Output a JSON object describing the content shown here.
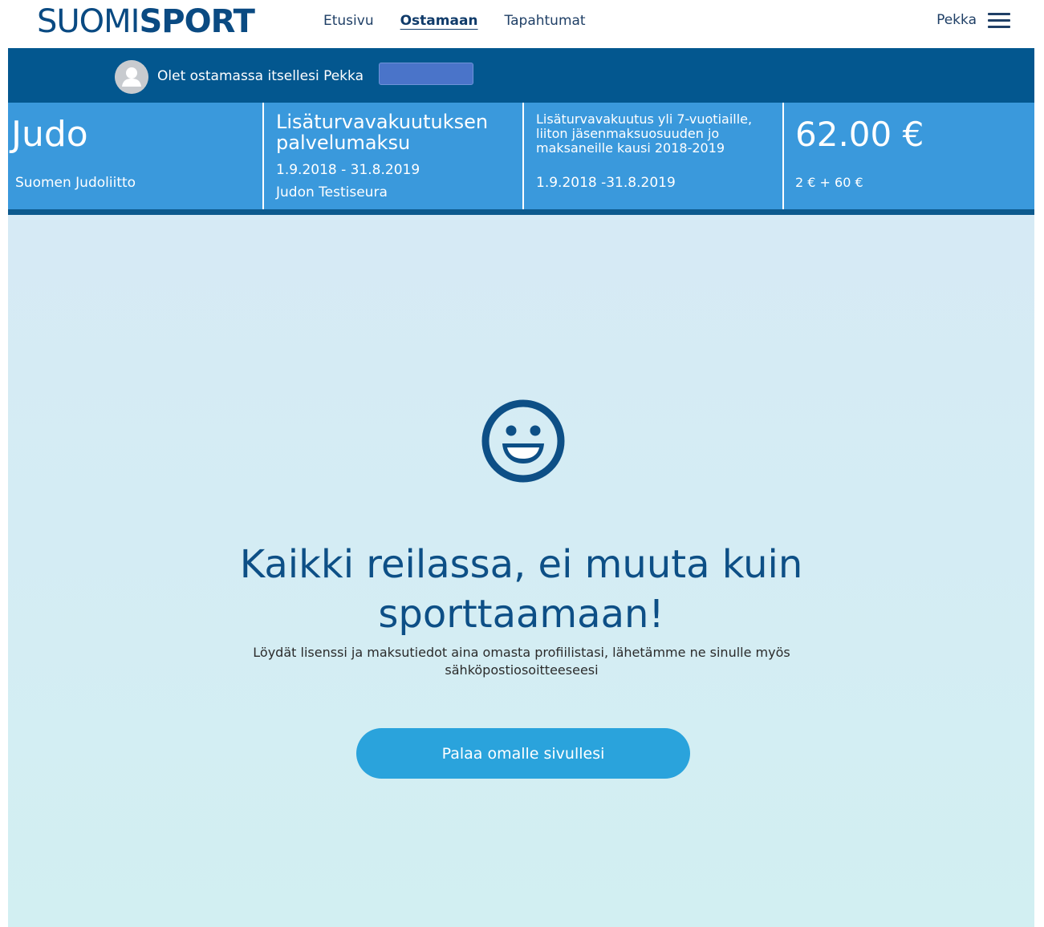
{
  "header": {
    "logo_light": "SUOMI",
    "logo_bold_1": "SP",
    "logo_bold_o": "O",
    "logo_bold_2": "RT",
    "nav": [
      {
        "label": "Etusivu",
        "active": false
      },
      {
        "label": "Ostamaan",
        "active": true
      },
      {
        "label": "Tapahtumat",
        "active": false
      }
    ],
    "user_name": "Pekka",
    "menu_icon": "hamburger-menu-icon"
  },
  "buyer": {
    "text": "Olet ostamassa itsellesi Pekka",
    "avatar_icon": "user-avatar-icon"
  },
  "product": {
    "sport": "Judo",
    "federation": "Suomen Judoliitto",
    "fee_title": "Lisäturvavakuutuksen palvelumaksu",
    "fee_period": "1.9.2018 - 31.8.2019",
    "club": "Judon Testiseura",
    "insurance_description": "Lisäturvavakuutus yli 7-vuotiaille, liiton jäsenmaksuosuuden jo maksaneille kausi 2018-2019",
    "insurance_period": "1.9.2018 -31.8.2019",
    "price": "62.00 €",
    "price_breakdown": "2 € + 60 €"
  },
  "success": {
    "icon": "smiley-face-icon",
    "heading_line1": "Kaikki reilassa, ei muuta kuin",
    "heading_line2": "sporttaamaan!",
    "subtext_line1": "Löydät lisenssi ja maksutiedot aina omasta profiilistasi, lähetämme ne sinulle myös",
    "subtext_line2": "sähköpostiosoitteeseesi",
    "button_label": "Palaa omalle sivullesi"
  },
  "colors": {
    "brand_dark": "#03578f",
    "brand_light": "#3a99dc",
    "button": "#2aa3dc",
    "heading": "#0d4f86"
  }
}
